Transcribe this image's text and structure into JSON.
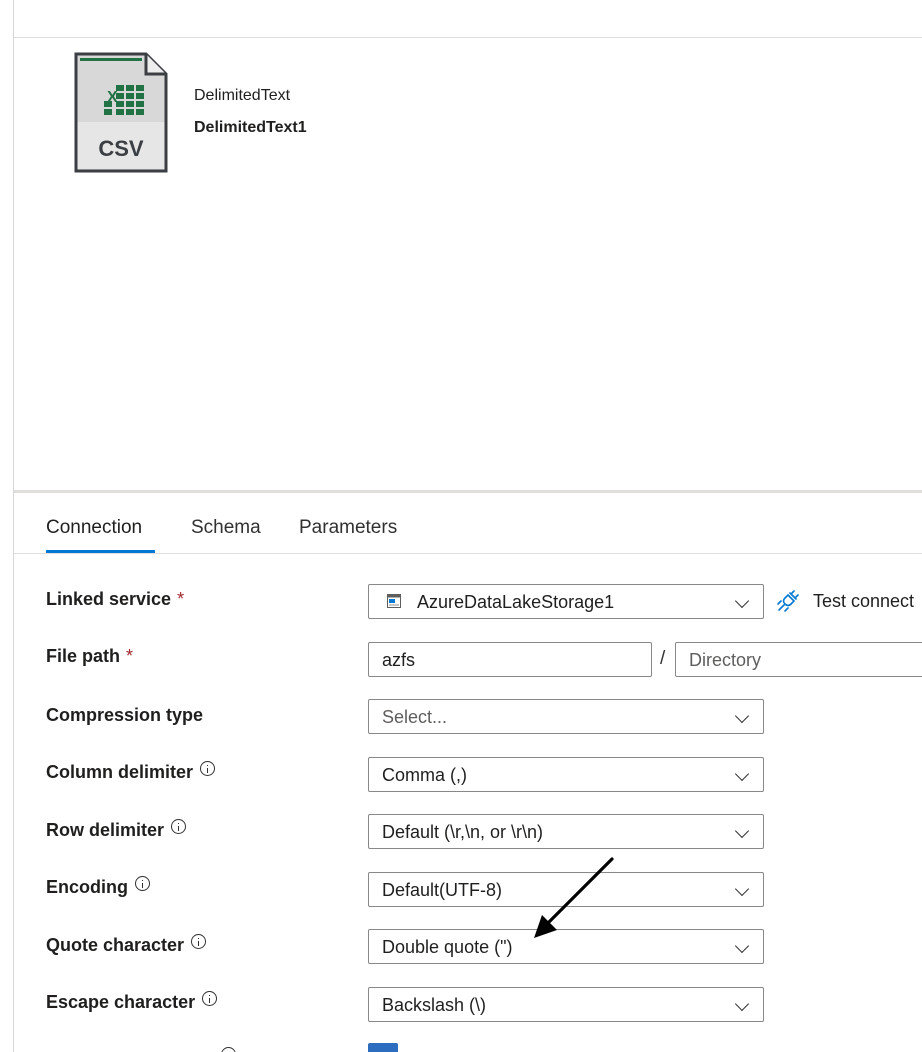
{
  "dataset": {
    "icon": "csv-file-icon",
    "icon_badge_text": "CSV",
    "type_label": "DelimitedText",
    "name": "DelimitedText1"
  },
  "tabs": [
    {
      "label": "Connection",
      "active": true
    },
    {
      "label": "Schema",
      "active": false
    },
    {
      "label": "Parameters",
      "active": false
    }
  ],
  "form": {
    "linked_service": {
      "label": "Linked service",
      "required_mark": "*",
      "value": "AzureDataLakeStorage1",
      "icon": "storage-account-icon",
      "test_connection_label": "Test connect",
      "test_connection_icon": "plug-connection-icon"
    },
    "file_path": {
      "label": "File path",
      "required_mark": "*",
      "container_value": "azfs",
      "separator": "/",
      "directory_placeholder": "Directory"
    },
    "compression_type": {
      "label": "Compression type",
      "placeholder": "Select..."
    },
    "column_delimiter": {
      "label": "Column delimiter",
      "value": "Comma (,)"
    },
    "row_delimiter": {
      "label": "Row delimiter",
      "value": "Default (\\r,\\n, or \\r\\n)"
    },
    "encoding": {
      "label": "Encoding",
      "value": "Default(UTF-8)"
    },
    "quote_character": {
      "label": "Quote character",
      "value": "Double quote (\")"
    },
    "escape_character": {
      "label": "Escape character",
      "value": "Backslash (\\)"
    }
  },
  "colors": {
    "accent": "#0078d4",
    "required": "#a4262c",
    "border": "#8a8886",
    "csv_green": "#217346",
    "csv_dark": "#3b3e42"
  }
}
